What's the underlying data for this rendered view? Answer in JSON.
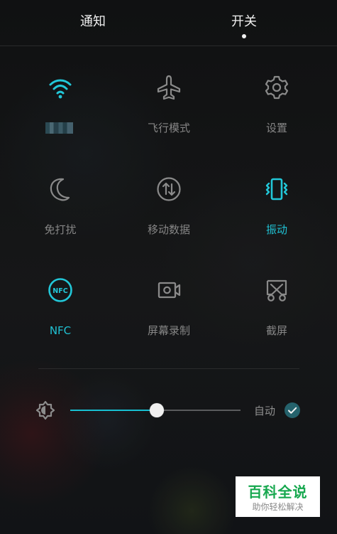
{
  "tabs": {
    "notifications": "通知",
    "switches": "开关",
    "selected": "开关"
  },
  "toggles": [
    {
      "id": "wifi",
      "label": "",
      "label_visible": "obscured",
      "icon": "wifi-icon",
      "state": "on"
    },
    {
      "id": "airplane",
      "label": "飞行模式",
      "icon": "airplane-icon",
      "state": "off"
    },
    {
      "id": "settings",
      "label": "设置",
      "icon": "gear-icon",
      "state": "off"
    },
    {
      "id": "do-not-disturb",
      "label": "免打扰",
      "icon": "moon-icon",
      "state": "off"
    },
    {
      "id": "mobile-data",
      "label": "移动数据",
      "icon": "mobile-data-icon",
      "state": "off"
    },
    {
      "id": "vibration",
      "label": "振动",
      "icon": "vibration-icon",
      "state": "on"
    },
    {
      "id": "nfc",
      "label": "NFC",
      "icon_text": "NFC",
      "icon": "nfc-icon",
      "state": "on"
    },
    {
      "id": "screen-recording",
      "label": "屏幕录制",
      "icon": "camera-recording-icon",
      "state": "off"
    },
    {
      "id": "screenshot",
      "label": "截屏",
      "icon": "scissors-icon",
      "state": "off"
    }
  ],
  "brightness": {
    "icon": "brightness-icon",
    "level": 0.51,
    "auto_label": "自动",
    "auto_enabled": true
  },
  "watermark": {
    "main": "百科全说",
    "sub": "助你轻松解决"
  },
  "colors": {
    "active": "#22c7d8",
    "inactive": "#8a8a8a",
    "background": "#111315",
    "watermark_green": "#17a84f"
  }
}
